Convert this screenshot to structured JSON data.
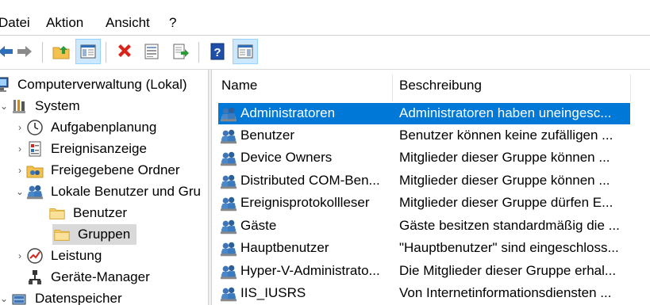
{
  "menu": {
    "items": [
      {
        "label": "Datei"
      },
      {
        "label": "Aktion"
      },
      {
        "label": "Ansicht"
      },
      {
        "label": "?"
      }
    ]
  },
  "toolbar": {
    "buttons": [
      {
        "name": "back",
        "icon": "back-arrow-icon"
      },
      {
        "name": "forward",
        "icon": "forward-arrow-icon"
      },
      {
        "name": "up",
        "icon": "up-folder-icon"
      },
      {
        "name": "show-hide-tree",
        "icon": "console-tree-icon"
      },
      {
        "name": "delete",
        "icon": "delete-icon"
      },
      {
        "name": "properties",
        "icon": "properties-icon"
      },
      {
        "name": "export",
        "icon": "export-list-icon"
      },
      {
        "name": "help",
        "icon": "help-icon"
      },
      {
        "name": "action-pane",
        "icon": "action-pane-icon"
      }
    ]
  },
  "tree": {
    "items": [
      {
        "label": "Computerverwaltung (Lokal)",
        "icon": "computer-management-icon"
      },
      {
        "label": "System",
        "icon": "system-tools-icon"
      },
      {
        "label": "Aufgabenplanung",
        "icon": "task-scheduler-icon"
      },
      {
        "label": "Ereignisanzeige",
        "icon": "event-viewer-icon"
      },
      {
        "label": "Freigegebene Ordner",
        "icon": "shared-folders-icon"
      },
      {
        "label": "Lokale Benutzer und Gru",
        "icon": "local-users-groups-icon"
      },
      {
        "label": "Benutzer",
        "icon": "folder-icon"
      },
      {
        "label": "Gruppen",
        "icon": "folder-icon"
      },
      {
        "label": "Leistung",
        "icon": "performance-icon"
      },
      {
        "label": "Geräte-Manager",
        "icon": "device-manager-icon"
      },
      {
        "label": "Datenspeicher",
        "icon": "storage-icon"
      }
    ]
  },
  "list": {
    "columns": [
      {
        "label": "Name"
      },
      {
        "label": "Beschreibung"
      }
    ],
    "rows": [
      {
        "name": "Administratoren",
        "desc": "Administratoren haben uneingesc..."
      },
      {
        "name": "Benutzer",
        "desc": "Benutzer können keine zufälligen ..."
      },
      {
        "name": "Device Owners",
        "desc": "Mitglieder dieser Gruppe können ..."
      },
      {
        "name": "Distributed COM-Ben...",
        "desc": "Mitglieder dieser Gruppe können ..."
      },
      {
        "name": "Ereignisprotokollleser",
        "desc": "Mitglieder dieser Gruppe dürfen E..."
      },
      {
        "name": "Gäste",
        "desc": "Gäste besitzen standardmäßig die ..."
      },
      {
        "name": "Hauptbenutzer",
        "desc": "\"Hauptbenutzer\" sind eingeschloss..."
      },
      {
        "name": "Hyper-V-Administrato...",
        "desc": "Die Mitglieder dieser Gruppe erhal..."
      },
      {
        "name": "IIS_IUSRS",
        "desc": "Von Internetinformationsdiensten ..."
      }
    ]
  },
  "colors": {
    "selection": "#0078d7",
    "tree_selection": "#d9d9d9",
    "toolbar_active": "#cce8ff"
  }
}
